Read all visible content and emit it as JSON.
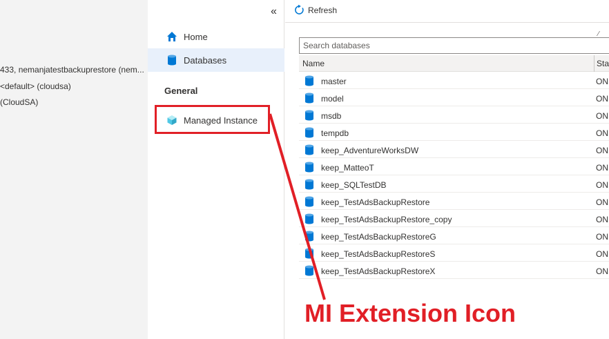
{
  "connection": {
    "lines": [
      "433, nemanjatestbackuprestore (nem...",
      "<default> (cloudsa)",
      "(CloudSA)"
    ]
  },
  "nav": {
    "collapse_icon": "double-chevron-left-icon",
    "items": [
      {
        "label": "Home",
        "icon": "home-icon"
      },
      {
        "label": "Databases",
        "icon": "database-icon"
      }
    ],
    "section_label": "General",
    "general_items": [
      {
        "label": "Managed Instance",
        "icon": "managed-instance-cube-icon"
      }
    ]
  },
  "toolbar": {
    "refresh_label": "Refresh",
    "refresh_icon": "refresh-icon"
  },
  "search": {
    "placeholder": "Search databases"
  },
  "grid": {
    "headers": {
      "name": "Name",
      "status": "Sta"
    },
    "rows": [
      {
        "name": "master",
        "status": "ON"
      },
      {
        "name": "model",
        "status": "ON"
      },
      {
        "name": "msdb",
        "status": "ON"
      },
      {
        "name": "tempdb",
        "status": "ON"
      },
      {
        "name": "keep_AdventureWorksDW",
        "status": "ON"
      },
      {
        "name": "keep_MatteoT",
        "status": "ON"
      },
      {
        "name": "keep_SQLTestDB",
        "status": "ON"
      },
      {
        "name": "keep_TestAdsBackupRestore",
        "status": "ON"
      },
      {
        "name": "keep_TestAdsBackupRestore_copy",
        "status": "ON"
      },
      {
        "name": "keep_TestAdsBackupRestoreG",
        "status": "ON"
      },
      {
        "name": "keep_TestAdsBackupRestoreS",
        "status": "ON"
      },
      {
        "name": "keep_TestAdsBackupRestoreX",
        "status": "ON"
      }
    ]
  },
  "annotation": {
    "text": "MI Extension Icon",
    "color": "#e11f26"
  },
  "colors": {
    "accent": "#0078d4",
    "selected_bg": "#e8f0fb",
    "highlight": "#e11f26"
  }
}
